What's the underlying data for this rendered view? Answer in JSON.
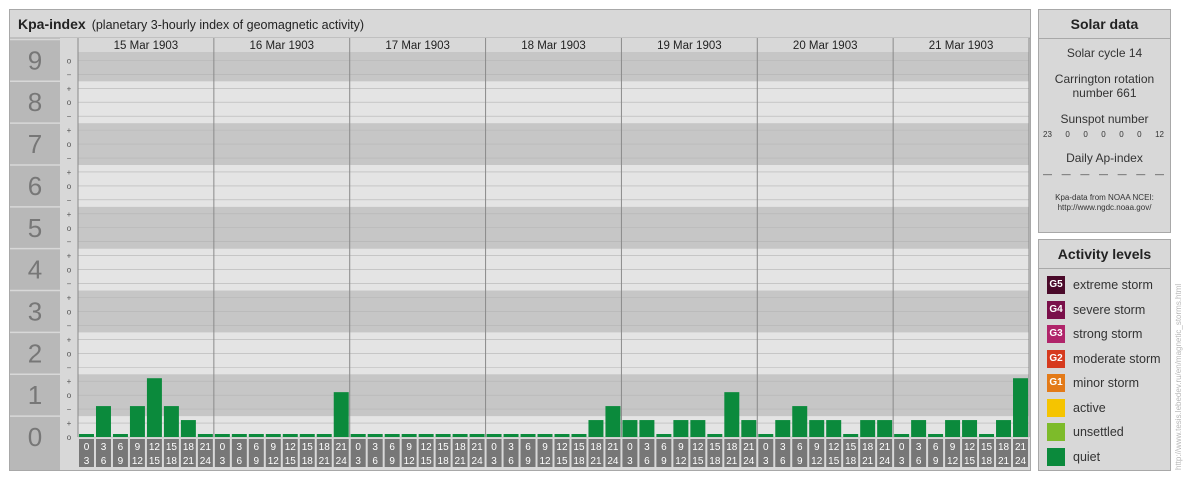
{
  "header": {
    "title": "Kpa-index",
    "subtitle": "(planetary 3-hourly index of geomagnetic activity)"
  },
  "chart_data": {
    "type": "bar",
    "ylim": [
      0,
      9
    ],
    "y_labels": [
      "0",
      "1",
      "2",
      "3",
      "4",
      "5",
      "6",
      "7",
      "8",
      "9"
    ],
    "sub_ticks": [
      "+",
      "o",
      "−"
    ],
    "days": [
      "15 Mar 1903",
      "16 Mar 1903",
      "17 Mar 1903",
      "18 Mar 1903",
      "19 Mar 1903",
      "20 Mar 1903",
      "21 Mar 1903"
    ],
    "interval_start": [
      "0",
      "3",
      "6",
      "9",
      "12",
      "15",
      "18",
      "21"
    ],
    "interval_end": [
      "3",
      "6",
      "9",
      "12",
      "15",
      "18",
      "21",
      "24"
    ],
    "values": [
      [
        0,
        0.667,
        0,
        0.667,
        1.333,
        0.667,
        0.333,
        0
      ],
      [
        0,
        0,
        0,
        0,
        0,
        0,
        0,
        1
      ],
      [
        0,
        0,
        0,
        0,
        0,
        0,
        0,
        0
      ],
      [
        0,
        0,
        0,
        0,
        0,
        0,
        0.333,
        0.667
      ],
      [
        0.333,
        0.333,
        0,
        0.333,
        0.333,
        0,
        1,
        0.333
      ],
      [
        0,
        0.333,
        0.667,
        0.333,
        0.333,
        0,
        0.333,
        0.333
      ],
      [
        0,
        0.333,
        0,
        0.333,
        0.333,
        0,
        0.333,
        1.333
      ]
    ],
    "bar_color": "#0b8a3c",
    "grid": true
  },
  "solar": {
    "title": "Solar data",
    "cycle": "Solar cycle 14",
    "carrington_1": "Carrington rotation",
    "carrington_2": "number 661",
    "sunspot_title": "Sunspot number",
    "sunspots": [
      "23",
      "0",
      "0",
      "0",
      "0",
      "0",
      "12"
    ],
    "ap_title": "Daily Ap-index",
    "ap": [
      "—",
      "—",
      "—",
      "—",
      "—",
      "—",
      "—"
    ],
    "credit_1": "Kpa-data from NOAA NCEI:",
    "credit_2": "http://www.ngdc.noaa.gov/"
  },
  "activity": {
    "title": "Activity levels",
    "items": [
      {
        "code": "G5",
        "label": "extreme storm",
        "color": "#4a0a2a"
      },
      {
        "code": "G4",
        "label": "severe storm",
        "color": "#7a0f4a"
      },
      {
        "code": "G3",
        "label": "strong storm",
        "color": "#b0246a"
      },
      {
        "code": "G2",
        "label": "moderate storm",
        "color": "#d63a1e"
      },
      {
        "code": "G1",
        "label": "minor storm",
        "color": "#e37a18"
      },
      {
        "code": "",
        "label": "active",
        "color": "#f5c400"
      },
      {
        "code": "",
        "label": "unsettled",
        "color": "#7dbb2a"
      },
      {
        "code": "",
        "label": "quiet",
        "color": "#0b8a3c"
      }
    ]
  },
  "watermark": "http://www.tesis.lebedev.ru/en/magnetic_storms.html"
}
